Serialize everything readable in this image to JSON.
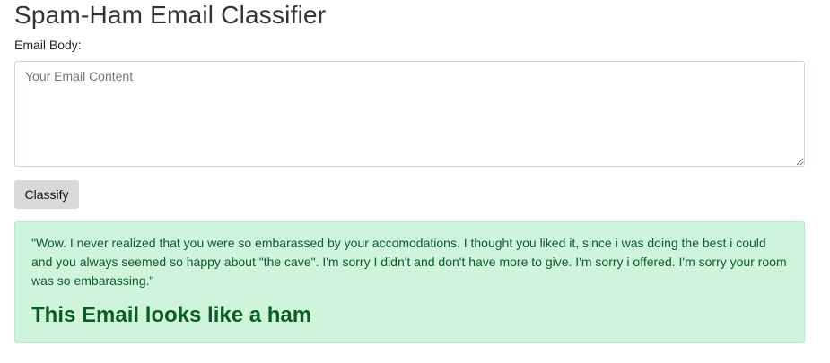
{
  "app": {
    "title": "Spam-Ham Email Classifier"
  },
  "form": {
    "email_label": "Email Body:",
    "email_value": "",
    "email_placeholder": "Your Email Content",
    "classify_label": "Classify"
  },
  "result": {
    "email_text": "\"Wow. I never realized that you were so embarassed by your accomodations. I thought you liked it, since i was doing the best i could and you always seemed so happy about \"the cave\". I'm sorry I didn't and don't have more to give. I'm sorry i offered. I'm sorry your room was so embarassing.\"",
    "verdict": "This Email looks like a ham",
    "colors": {
      "background": "#cff4dc",
      "text": "#0f5b2a"
    }
  }
}
